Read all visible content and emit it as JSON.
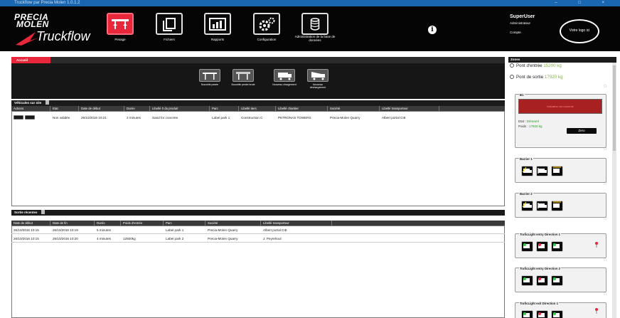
{
  "titlebar": {
    "title": "Truckflow par Precia Molen 1.0.1.2",
    "controls": "– □ ×"
  },
  "header": {
    "brand_line1": "PRECIA",
    "brand_line2": "MOLEN",
    "product": "Truckflow",
    "nav": [
      {
        "label": "Pesage",
        "icon": "scale-icon",
        "active": true
      },
      {
        "label": "Fichiers",
        "icon": "files-icon",
        "active": false
      },
      {
        "label": "Rapports",
        "icon": "chart-icon",
        "active": false
      },
      {
        "label": "Configuration",
        "icon": "gears-icon",
        "active": false
      },
      {
        "label": "Administration de la base de données",
        "icon": "database-icon",
        "active": false
      }
    ],
    "info": "i",
    "user": {
      "name": "SuperUser",
      "role": "Administrateur",
      "account": "Compte"
    },
    "customer_logo": "Votre logo ici"
  },
  "tabs": [
    {
      "label": "Accueil",
      "active": true
    }
  ],
  "quick_actions": [
    {
      "label": "Nouvelle pesée",
      "icon": "truck-weigh-icon"
    },
    {
      "label": "Nouvelle pesée brute",
      "icon": "truck-gross-icon"
    },
    {
      "label": "Nouveau chargement",
      "icon": "truck-load-icon"
    },
    {
      "label": "Nouveau déchargement",
      "icon": "truck-unload-icon"
    }
  ],
  "vehicles_on_site": {
    "title": "Véhicules sur site",
    "columns": [
      "Actions",
      "Etat",
      "Date de début",
      "Durée",
      "Libellé 0 du produit",
      "Parc",
      "Libellé tiers",
      "Libellé chantier",
      "Société",
      "Libellé transporteur"
    ],
    "rows": [
      {
        "etat": "Non validée",
        "date_debut": "26/10/2016 10:21",
        "duree": "2 minutes",
        "produit": "Sand for concrete",
        "parc": "Label park 1",
        "tiers": "Construction C",
        "chantier": "PETRONAS TOWERS",
        "societe": "Precia-Molen Quarry",
        "transporteur": "Albert portal CIE"
      }
    ]
  },
  "recent_exits": {
    "title": "Sortie récentes",
    "columns": [
      "Date de début",
      "Date de fin",
      "Durée",
      "Poids d'entrée",
      "Parc",
      "Société",
      "Libellé transporteur"
    ],
    "rows": [
      {
        "debut": "26/10/2016 10:15",
        "fin": "26/10/2016 10:19",
        "duree": "5 minutes",
        "poids": "",
        "parc": "Label park 1",
        "societe": "Precia-Molen Quarry",
        "transporteur": "Albert portal CIE"
      },
      {
        "debut": "26/10/2016 10:15",
        "fin": "26/10/2016 10:20",
        "duree": "4 minutes",
        "poids": "12500kg",
        "parc": "Label park 2",
        "societe": "Precia-Molen Quarry",
        "transporteur": "J. Peyrehoul"
      }
    ]
  },
  "zones": {
    "title": "Zones",
    "entry_label": "Pont d'entrée",
    "entry_weight": "15200 kg",
    "exit_label": "Pont de sortie",
    "exit_weight": "17920 kg",
    "b1": {
      "title": "B1",
      "display": "Indicateur non connecté",
      "etat_label": "Etat :",
      "etat_value": "Démarré",
      "poids_label": "Poids :",
      "poids_value": "17920 kg",
      "zero_label": "Zero"
    },
    "barrier1": "Barrier 1",
    "barrier2": "Barrier 2",
    "tl_entry1": "TraficLight entry Direction 1",
    "tl_entry2": "TraficLight entry Direction 2",
    "tl_exit1": "TraficLight exit Direction 1",
    "colors": {
      "accent": "#e8273a",
      "weight_green": "#86b34a",
      "status_green": "#2a9a2a"
    }
  }
}
